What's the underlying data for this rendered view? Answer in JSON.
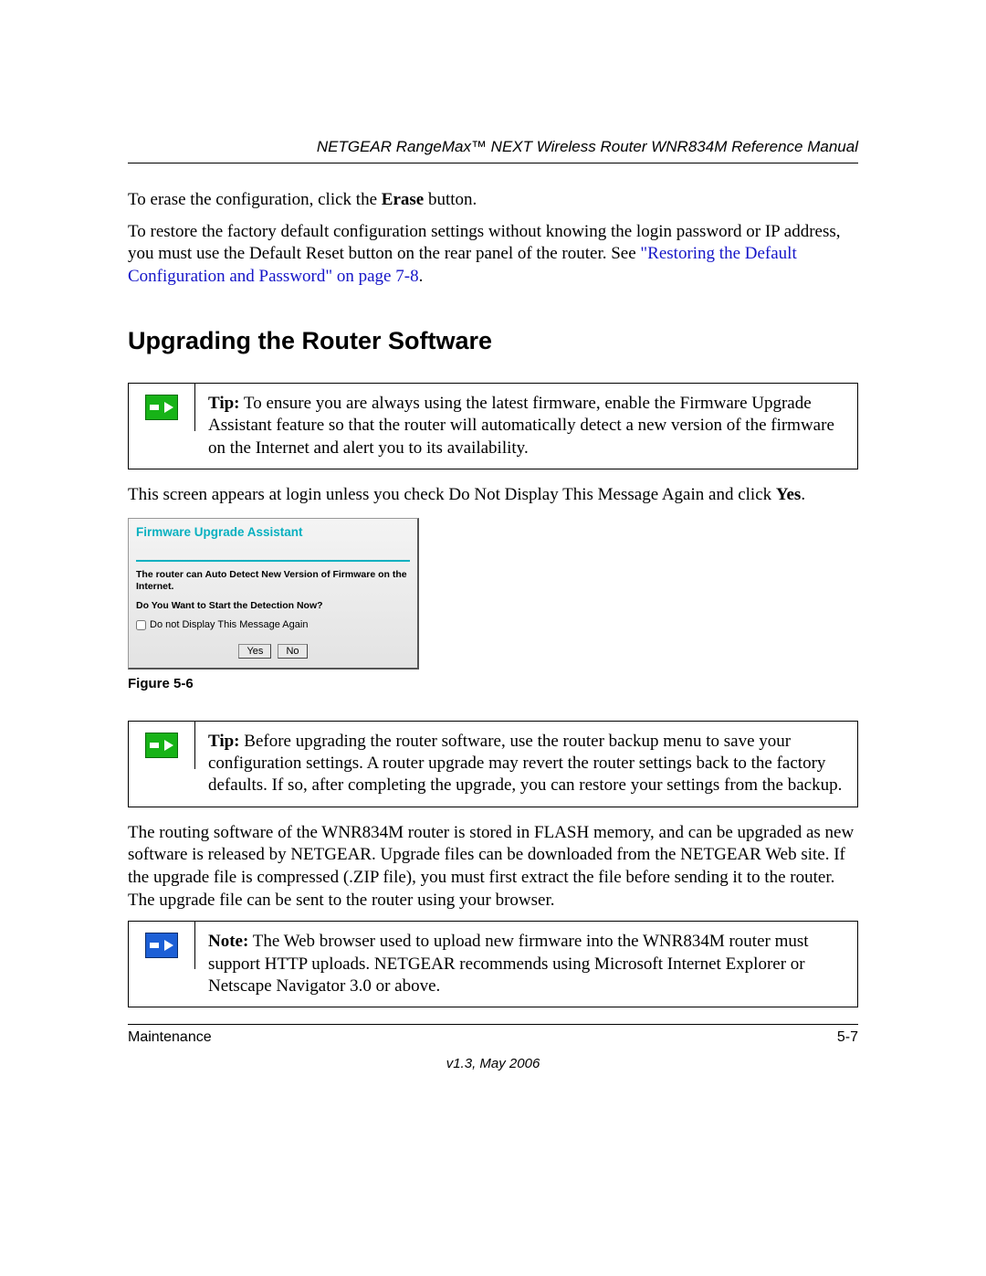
{
  "header": {
    "running": "NETGEAR RangeMax™ NEXT Wireless Router WNR834M Reference Manual"
  },
  "intro": {
    "p1_a": "To erase the configuration, click the ",
    "p1_b": "Erase",
    "p1_c": " button.",
    "p2_a": "To restore the factory default configuration settings without knowing the login password or IP address, you must use the Default Reset button on the rear panel of the router. See ",
    "p2_link": "\"Restoring the Default Configuration and Password\" on page 7-8",
    "p2_c": "."
  },
  "heading": "Upgrading the Router Software",
  "tip1": {
    "label": "Tip:",
    "text": " To ensure you are always using the latest firmware, enable the Firmware Upgrade Assistant feature so that the router will automatically detect a new version of the firmware on the Internet and alert you to its availability."
  },
  "after_tip1_a": "This screen appears at login unless you check Do Not Display This Message Again and click ",
  "after_tip1_b": "Yes",
  "after_tip1_c": ".",
  "firmware": {
    "title": "Firmware Upgrade Assistant",
    "line1": "The router can Auto Detect New Version of Firmware on the Internet.",
    "line2": "Do You Want to Start the Detection Now?",
    "checkbox_label": "Do not Display This Message Again",
    "yes": "Yes",
    "no": "No"
  },
  "figure_label": "Figure 5-6",
  "tip2": {
    "label": "Tip:",
    "text": " Before upgrading the router software, use the router backup menu to save your configuration settings. A router upgrade may revert the router settings back to the factory defaults. If so, after completing the upgrade, you can restore your settings from the backup."
  },
  "para_flash": "The routing software of the WNR834M router is stored in FLASH memory, and can be upgraded as new software is released by NETGEAR. Upgrade files can be downloaded from the NETGEAR Web site. If the upgrade file is compressed (.ZIP file), you must first extract the file before sending it to the router. The upgrade file can be sent to the router using your browser.",
  "note": {
    "label": "Note:",
    "text": " The Web browser used to upload new firmware into the WNR834M router must support HTTP uploads. NETGEAR recommends using Microsoft Internet Explorer or Netscape Navigator 3.0 or above."
  },
  "footer": {
    "section": "Maintenance",
    "page": "5-7",
    "version": "v1.3, May 2006"
  }
}
